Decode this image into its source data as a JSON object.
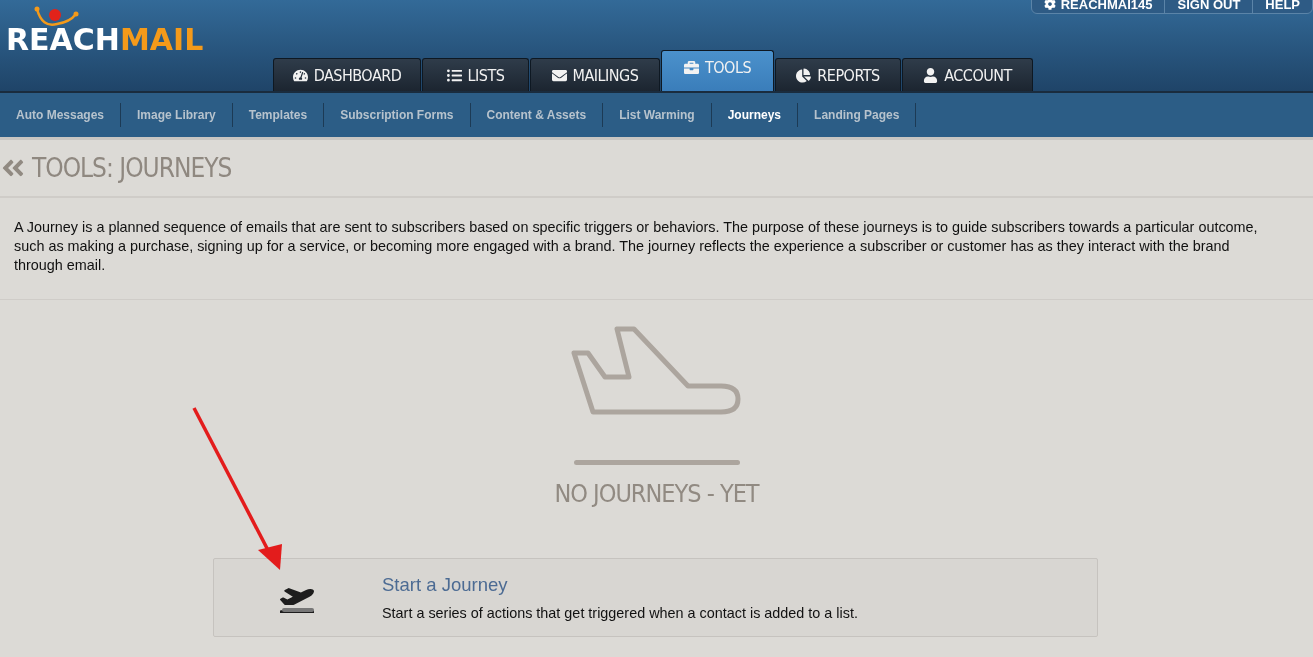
{
  "logo": {
    "parts": [
      {
        "text": "REACH",
        "kind": "light"
      },
      {
        "text": "MAIL",
        "kind": "accent"
      }
    ]
  },
  "user_links": [
    {
      "label": "REACHMAI145",
      "kind": "settings"
    },
    {
      "label": "SIGN OUT",
      "kind": "plain"
    },
    {
      "label": "HELP",
      "kind": "plain"
    }
  ],
  "main_nav": [
    {
      "label": "DASHBOARD",
      "selected": false
    },
    {
      "label": "LISTS",
      "selected": false
    },
    {
      "label": "MAILINGS",
      "selected": false
    },
    {
      "label": "TOOLS",
      "selected": true
    },
    {
      "label": "REPORTS",
      "selected": false
    },
    {
      "label": "ACCOUNT",
      "selected": false
    }
  ],
  "sub_nav": [
    {
      "label": "Auto Messages",
      "selected": false
    },
    {
      "label": "Image Library",
      "selected": false
    },
    {
      "label": "Templates",
      "selected": false
    },
    {
      "label": "Subscription Forms",
      "selected": false
    },
    {
      "label": "Content & Assets",
      "selected": false
    },
    {
      "label": "List Warming",
      "selected": false
    },
    {
      "label": "Journeys",
      "selected": true
    },
    {
      "label": "Landing Pages",
      "selected": false
    }
  ],
  "page_title": "TOOLS: JOURNEYS",
  "description": "A Journey is a planned sequence of emails that are sent to subscribers based on specific triggers or behaviors. The purpose of these journeys is to guide subscribers towards a particular outcome, such as making a purchase, signing up for a service, or becoming more engaged with a brand. The journey reflects the experience a subscriber or customer has as they interact with the brand through email.",
  "empty_state": {
    "message": "NO JOURNEYS - YET"
  },
  "action_card": {
    "title": "Start a Journey",
    "text": "Start a series of actions that get triggered when a contact is added to a list."
  }
}
